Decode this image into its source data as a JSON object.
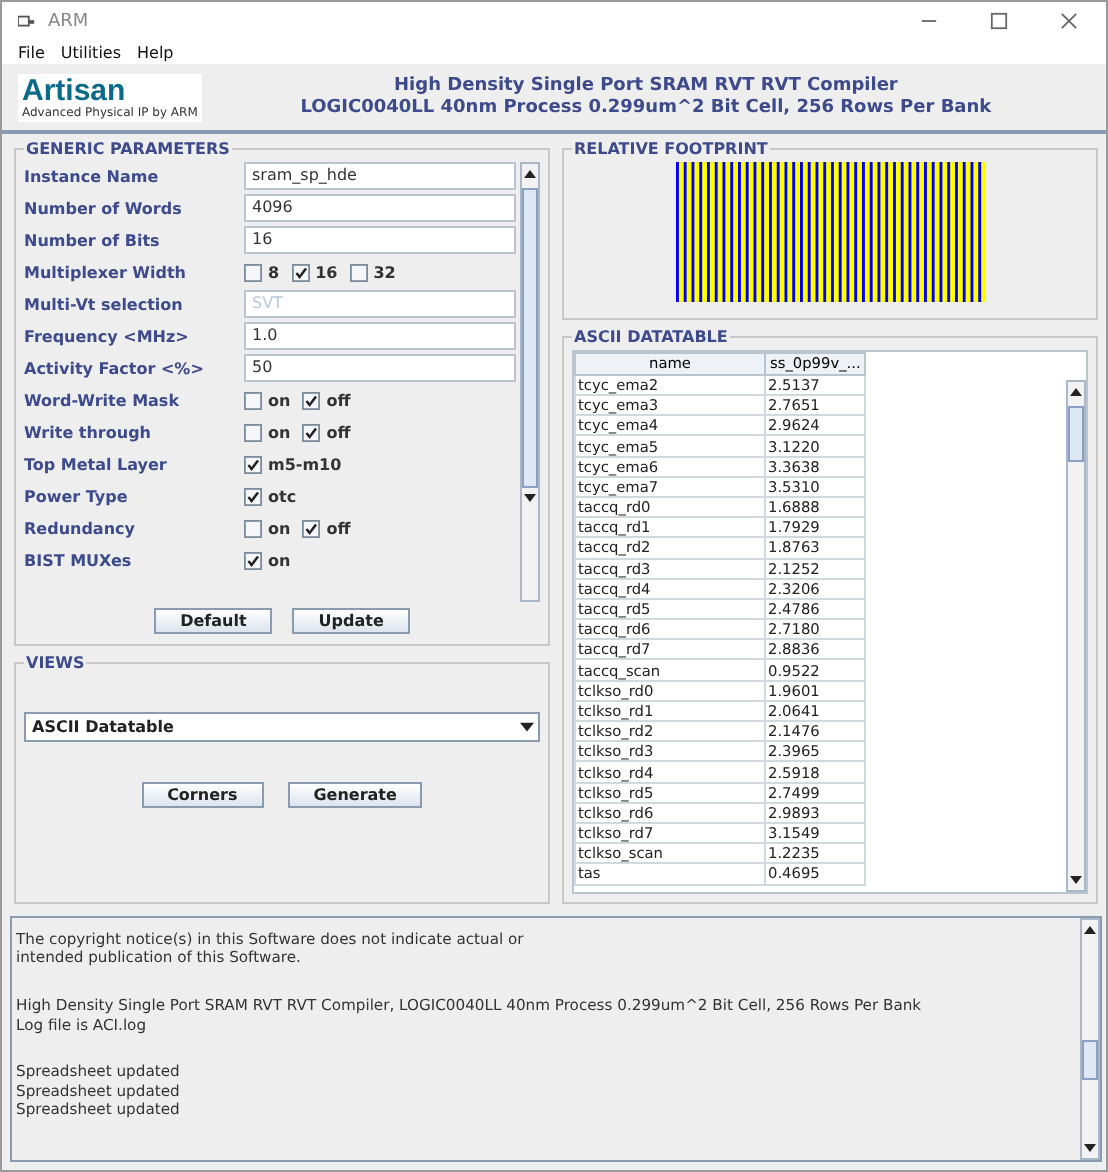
{
  "window": {
    "title": "ARM"
  },
  "menu": [
    "File",
    "Utilities",
    "Help"
  ],
  "logo": {
    "name": "Artisan",
    "tagline": "Advanced Physical IP by ARM"
  },
  "header": [
    "High Density Single Port SRAM RVT RVT Compiler",
    "LOGIC0040LL 40nm Process 0.299um^2 Bit Cell, 256 Rows Per Bank"
  ],
  "generic_parameters": {
    "title": "GENERIC PARAMETERS",
    "rows": [
      {
        "label": "Instance Name",
        "kind": "text",
        "value": "sram_sp_hde",
        "disabled": false
      },
      {
        "label": "Number of Words",
        "kind": "text",
        "value": "4096",
        "disabled": false
      },
      {
        "label": "Number of Bits",
        "kind": "text",
        "value": "16",
        "disabled": false
      },
      {
        "label": "Multiplexer Width",
        "kind": "options",
        "options": [
          {
            "label": "8",
            "checked": false
          },
          {
            "label": "16",
            "checked": true
          },
          {
            "label": "32",
            "checked": false
          }
        ]
      },
      {
        "label": "Multi-Vt selection",
        "kind": "text",
        "value": "SVT",
        "disabled": true
      },
      {
        "label": "Frequency <MHz>",
        "kind": "text",
        "value": "1.0",
        "disabled": false
      },
      {
        "label": "Activity Factor <%>",
        "kind": "text",
        "value": "50",
        "disabled": false
      },
      {
        "label": "Word-Write Mask",
        "kind": "options",
        "options": [
          {
            "label": "on",
            "checked": false
          },
          {
            "label": "off",
            "checked": true
          }
        ]
      },
      {
        "label": "Write through",
        "kind": "options",
        "options": [
          {
            "label": "on",
            "checked": false
          },
          {
            "label": "off",
            "checked": true
          }
        ]
      },
      {
        "label": "Top Metal Layer",
        "kind": "options",
        "options": [
          {
            "label": "m5-m10",
            "checked": true
          }
        ]
      },
      {
        "label": "Power Type",
        "kind": "options",
        "options": [
          {
            "label": "otc",
            "checked": true
          }
        ]
      },
      {
        "label": "Redundancy",
        "kind": "options",
        "options": [
          {
            "label": "on",
            "checked": false
          },
          {
            "label": "off",
            "checked": true
          }
        ]
      },
      {
        "label": "BIST MUXes",
        "kind": "options",
        "options": [
          {
            "label": "on",
            "checked": true
          }
        ]
      }
    ],
    "buttons": [
      "Default",
      "Update"
    ]
  },
  "views": {
    "title": "VIEWS",
    "dropdown": "ASCII Datatable",
    "buttons": [
      "Corners",
      "Generate"
    ]
  },
  "relative_footprint": {
    "title": "RELATIVE FOOTPRINT"
  },
  "ascii_datatable": {
    "title": "ASCII DATATABLE",
    "columns": [
      "name",
      "ss_0p99v_..."
    ],
    "rows": [
      [
        "tcyc_ema2",
        "2.5137"
      ],
      [
        "tcyc_ema3",
        "2.7651"
      ],
      [
        "tcyc_ema4",
        "2.9624"
      ],
      [
        "tcyc_ema5",
        "3.1220"
      ],
      [
        "tcyc_ema6",
        "3.3638"
      ],
      [
        "tcyc_ema7",
        "3.5310"
      ],
      [
        "taccq_rd0",
        "1.6888"
      ],
      [
        "taccq_rd1",
        "1.7929"
      ],
      [
        "taccq_rd2",
        "1.8763"
      ],
      [
        "taccq_rd3",
        "2.1252"
      ],
      [
        "taccq_rd4",
        "2.3206"
      ],
      [
        "taccq_rd5",
        "2.4786"
      ],
      [
        "taccq_rd6",
        "2.7180"
      ],
      [
        "taccq_rd7",
        "2.8836"
      ],
      [
        "taccq_scan",
        "0.9522"
      ],
      [
        "tclkso_rd0",
        "1.9601"
      ],
      [
        "tclkso_rd1",
        "2.0641"
      ],
      [
        "tclkso_rd2",
        "2.1476"
      ],
      [
        "tclkso_rd3",
        "2.3965"
      ],
      [
        "tclkso_rd4",
        "2.5918"
      ],
      [
        "tclkso_rd5",
        "2.7499"
      ],
      [
        "tclkso_rd6",
        "2.9893"
      ],
      [
        "tclkso_rd7",
        "3.1549"
      ],
      [
        "tclkso_scan",
        "1.2235"
      ],
      [
        "tas",
        "0.4695"
      ]
    ]
  },
  "log": [
    [
      "The copyright notice(s) in this Software does not indicate actual or",
      "intended publication of this Software."
    ],
    [
      "High Density Single Port SRAM RVT RVT Compiler, LOGIC0040LL 40nm Process 0.299um^2 Bit Cell, 256 Rows Per Bank",
      "Log file is ACI.log"
    ],
    [
      "Spreadsheet updated",
      "Spreadsheet updated",
      "Spreadsheet updated"
    ]
  ]
}
